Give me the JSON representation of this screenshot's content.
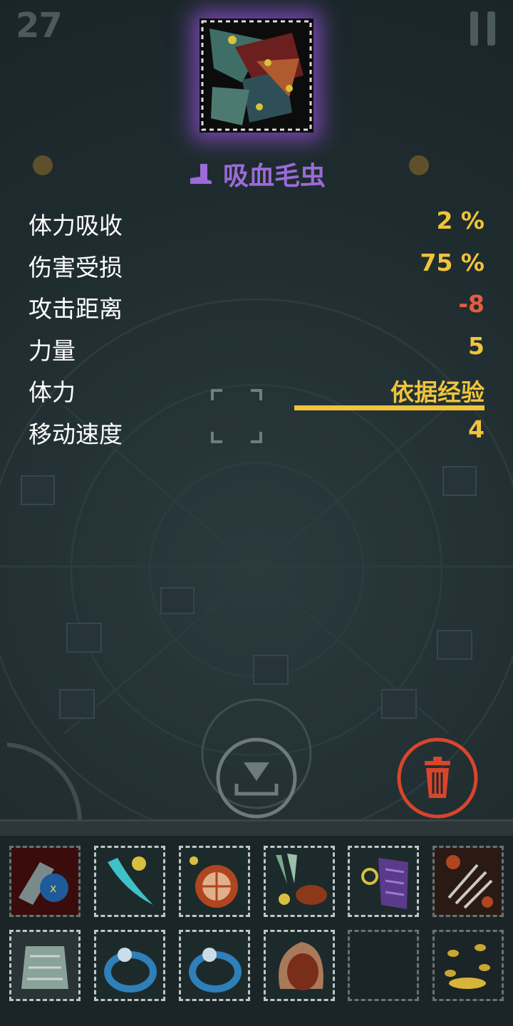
{
  "hud": {
    "level": "27"
  },
  "item": {
    "name": "吸血毛虫",
    "rarity_color": "#9b6bd9",
    "glow_color": "#9650dc"
  },
  "stats": [
    {
      "label": "体力吸收",
      "value": "2 %"
    },
    {
      "label": "伤害受损",
      "value": "75 %"
    },
    {
      "label": "攻击距离",
      "value": "-8"
    },
    {
      "label": "力量",
      "value": "5"
    },
    {
      "label": "体力",
      "value": "依据经验"
    },
    {
      "label": "移动速度",
      "value": "4"
    }
  ],
  "colors": {
    "value": "#f0c43a",
    "negative": "#e25d3f",
    "trash": "#d9452b"
  },
  "inventory": [
    {
      "icon": "blue-gauntlet-icon"
    },
    {
      "icon": "cyan-blade-icon"
    },
    {
      "icon": "round-shield-icon"
    },
    {
      "icon": "herb-bundle-icon"
    },
    {
      "icon": "purple-armor-icon"
    },
    {
      "icon": "spiked-gauntlet-icon"
    },
    {
      "icon": "pale-armor-icon"
    },
    {
      "icon": "blue-ring-icon"
    },
    {
      "icon": "blue-ring-icon"
    },
    {
      "icon": "brown-pouch-icon"
    },
    {
      "icon": "empty-slot"
    },
    {
      "icon": "gold-coins-icon"
    }
  ]
}
